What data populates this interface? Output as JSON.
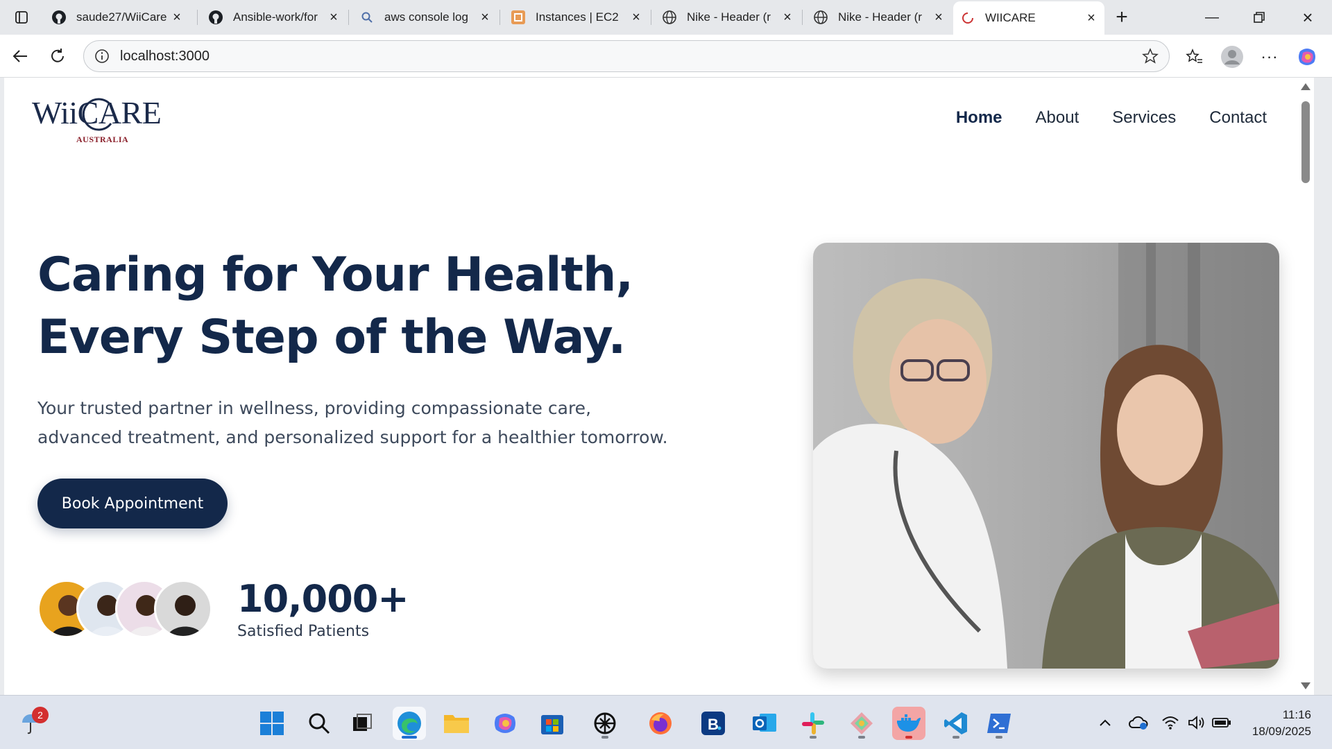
{
  "browser": {
    "tabs": [
      {
        "title": "saude27/WiiCare",
        "favicon": "github-icon"
      },
      {
        "title": "Ansible-work/for",
        "favicon": "github-icon"
      },
      {
        "title": "aws console log",
        "favicon": "search-icon"
      },
      {
        "title": "Instances | EC2",
        "favicon": "aws-icon"
      },
      {
        "title": "Nike - Header (r",
        "favicon": "globe-icon"
      },
      {
        "title": "Nike - Header (r",
        "favicon": "globe-icon"
      },
      {
        "title": "WIICARE",
        "favicon": "loading-icon",
        "active": true
      }
    ],
    "address": "localhost:3000"
  },
  "site": {
    "logo": {
      "main": "WiiCARE",
      "sub": "AUSTRALIA"
    },
    "nav": [
      {
        "label": "Home",
        "active": true
      },
      {
        "label": "About"
      },
      {
        "label": "Services"
      },
      {
        "label": "Contact"
      }
    ],
    "hero": {
      "title_line1": "Caring for Your Health,",
      "title_line2": "Every Step of the Way.",
      "subtitle_line1": "Your trusted partner in wellness, providing compassionate care,",
      "subtitle_line2": "advanced treatment, and personalized support for a healthier tomorrow.",
      "cta": "Book Appointment",
      "stat_value": "10,000+",
      "stat_label": "Satisfied Patients"
    },
    "colors": {
      "primary": "#13284a",
      "accent": "#8a1f2a"
    }
  },
  "taskbar": {
    "notification_count": "2",
    "time": "11:16",
    "date": "18/09/2025",
    "apps": [
      "start-icon",
      "search-icon",
      "task-view-icon",
      "edge-icon",
      "file-explorer-icon",
      "copilot-icon",
      "store-icon",
      "chatgpt-icon",
      "firefox-icon",
      "booking-icon",
      "outlook-icon",
      "slack-icon",
      "git-icon",
      "docker-icon",
      "vscode-icon",
      "terminal-icon"
    ]
  }
}
